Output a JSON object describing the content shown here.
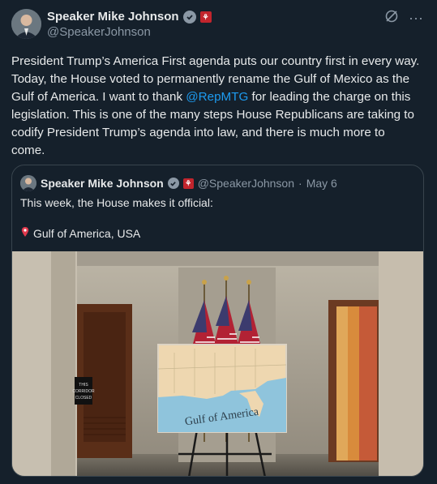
{
  "author": {
    "name": "Speaker Mike Johnson",
    "handle": "@SpeakerJohnson",
    "badge_icon": "verified-badge-icon",
    "flag_icon": "house-seal-icon"
  },
  "post": {
    "text_before_mention": "President Trump’s America First agenda puts our country first in every way. Today, the House voted to permanently rename the Gulf of Mexico as the Gulf of America. I want to thank ",
    "mention": "@RepMTG",
    "text_after_mention": " for leading the charge on this legislation. This is one of the many steps House Republicans are taking to codify President Trump’s agenda into law, and there is much more to come."
  },
  "quote": {
    "name": "Speaker Mike Johnson",
    "handle": "@SpeakerJohnson",
    "date": "May 6",
    "line1": "This week, the House makes it official:",
    "location": "Gulf of America, USA",
    "sign_text": "Gulf of America",
    "door_sign": "THIS\nCORRIDOR\nCLOSED"
  },
  "actions": {
    "grok_icon": "grok-icon",
    "more_icon": "more-options-icon",
    "more_glyph": "···"
  },
  "colors": {
    "background": "#15202b",
    "text": "#e7e9ea",
    "muted": "#8b98a5",
    "link": "#1d9bf0",
    "border": "#38444d"
  }
}
